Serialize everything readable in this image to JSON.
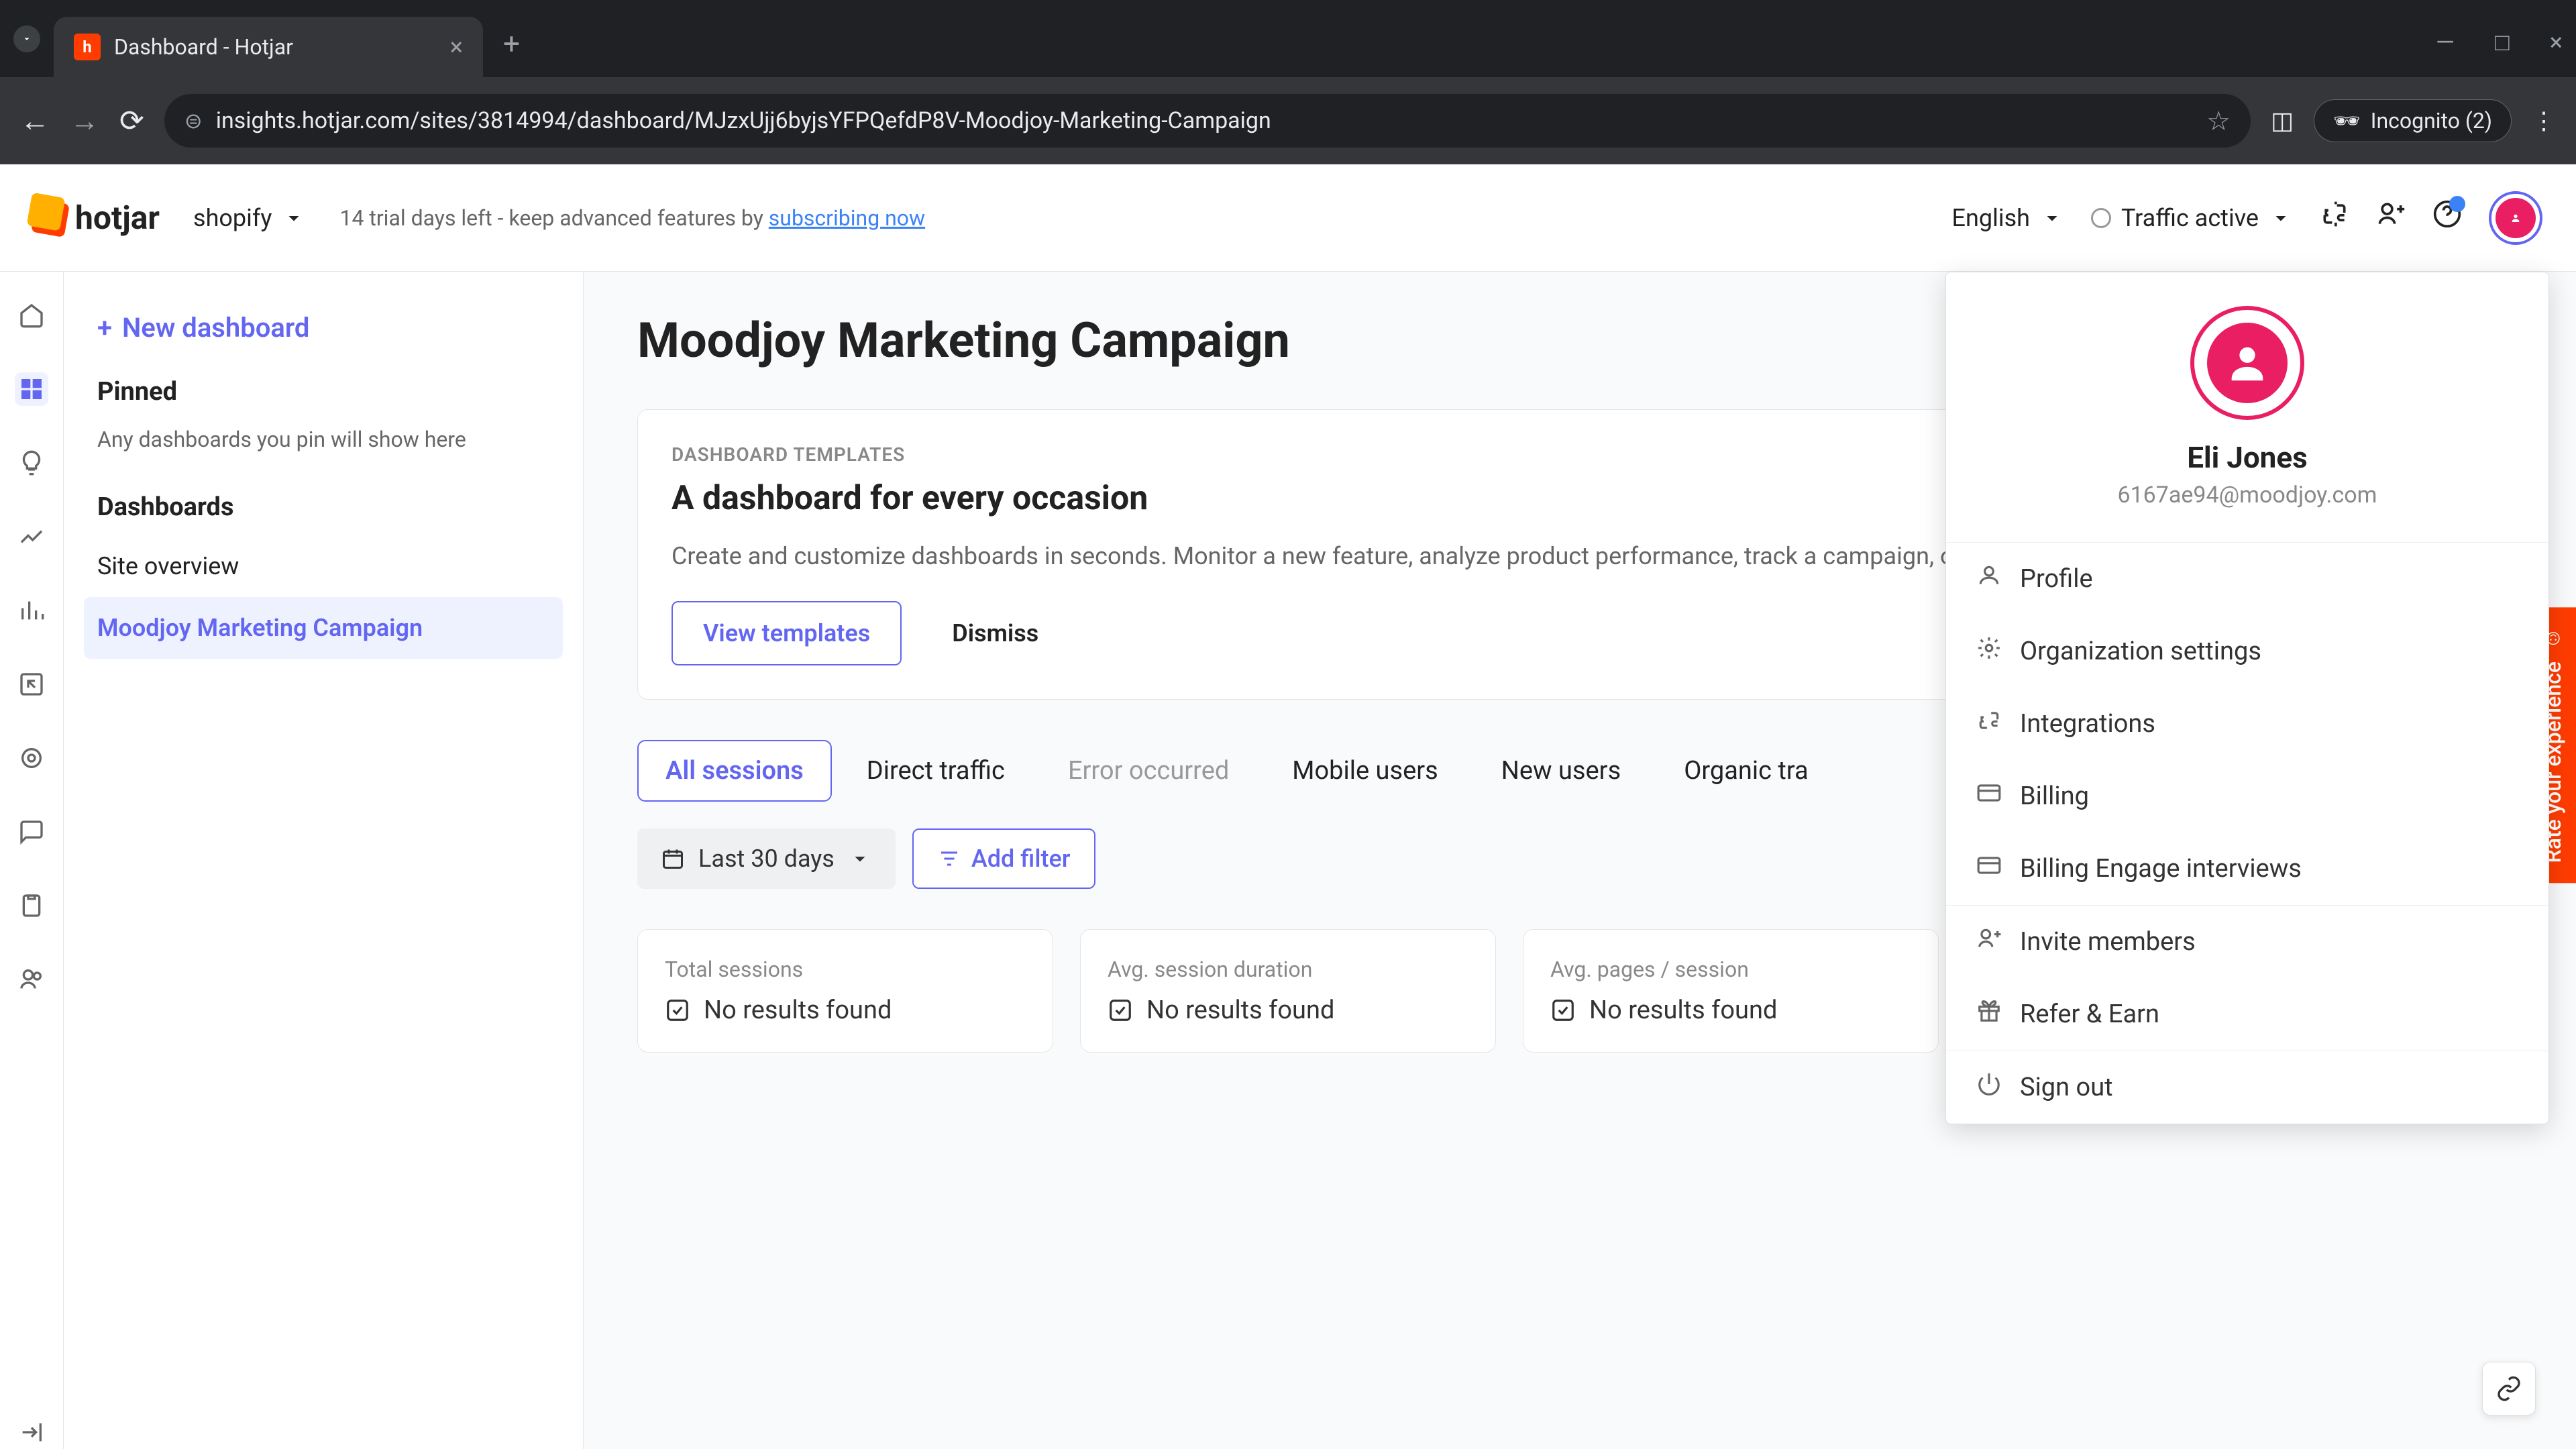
{
  "browser": {
    "tab_title": "Dashboard - Hotjar",
    "url": "insights.hotjar.com/sites/3814994/dashboard/MJzxUjj6byjsYFPQefdP8V-Moodjoy-Marketing-Campaign",
    "incognito_label": "Incognito (2)"
  },
  "header": {
    "logo_text": "hotjar",
    "org_name": "shopify",
    "trial_text": "14 trial days left - keep advanced features by ",
    "trial_link": "subscribing now",
    "language": "English",
    "traffic_status": "Traffic active"
  },
  "sidebar": {
    "new_dashboard": "New dashboard",
    "pinned_title": "Pinned",
    "pinned_empty": "Any dashboards you pin will show here",
    "dashboards_title": "Dashboards",
    "items": [
      {
        "label": "Site overview",
        "active": false
      },
      {
        "label": "Moodjoy Marketing Campaign",
        "active": true
      }
    ]
  },
  "page": {
    "title": "Moodjoy Marketing Campaign"
  },
  "promo": {
    "eyebrow": "DASHBOARD TEMPLATES",
    "title": "A dashboard for every occasion",
    "description": "Create and customize dashboards in seconds. Monitor a new feature, analyze product performance, track a campaign, or identify issues.",
    "view_btn": "View templates",
    "dismiss_btn": "Dismiss"
  },
  "tabs": [
    {
      "label": "All sessions",
      "active": true
    },
    {
      "label": "Direct traffic"
    },
    {
      "label": "Error occurred",
      "error": true
    },
    {
      "label": "Mobile users"
    },
    {
      "label": "New users"
    },
    {
      "label": "Organic tra"
    }
  ],
  "filters": {
    "date_range": "Last 30 days",
    "add_filter": "Add filter"
  },
  "metrics": [
    {
      "label": "Total sessions",
      "value": "No results found"
    },
    {
      "label": "Avg. session duration",
      "value": "No results found"
    },
    {
      "label": "Avg. pages / session",
      "value": "No results found"
    }
  ],
  "user_menu": {
    "name": "Eli Jones",
    "email": "6167ae94@moodjoy.com",
    "items": [
      {
        "label": "Profile",
        "icon": "user"
      },
      {
        "label": "Organization settings",
        "icon": "gear"
      },
      {
        "label": "Integrations",
        "icon": "puzzle"
      },
      {
        "label": "Billing",
        "icon": "card"
      },
      {
        "label": "Billing Engage interviews",
        "icon": "card"
      }
    ],
    "invite": "Invite members",
    "refer": "Refer & Earn",
    "signout": "Sign out"
  },
  "feedback_label": "Rate your experience"
}
